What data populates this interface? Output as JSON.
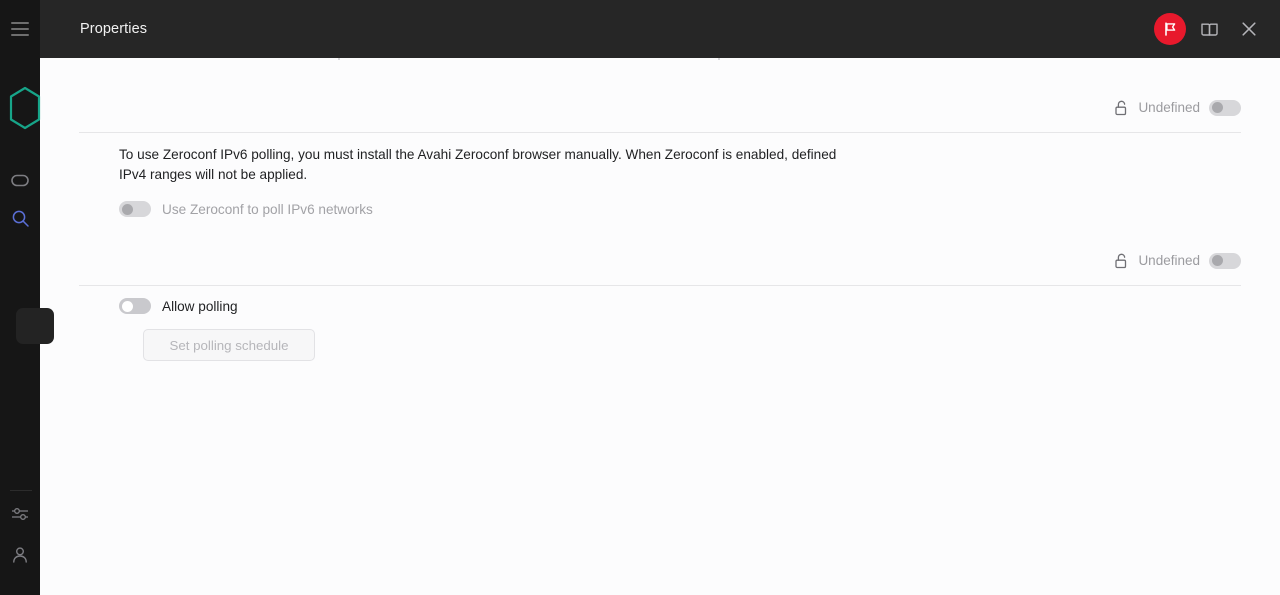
{
  "window": {
    "title": "Properties"
  },
  "header": {
    "title": "Properties",
    "actions": [
      {
        "name": "flag-button",
        "icon": "flag-icon",
        "color": "#e8192c"
      },
      {
        "name": "book-button",
        "icon": "book-icon"
      },
      {
        "name": "close-button",
        "icon": "close-icon"
      }
    ]
  },
  "sidebar": {
    "menu_icon": "hamburger-menu-icon",
    "logo": "hexagon-logo",
    "logo_color": "#17a589",
    "items": [
      {
        "name": "tag-icon"
      },
      {
        "name": "search-icon",
        "color": "#5b6fd6"
      },
      {
        "name": "tune-icon"
      },
      {
        "name": "user-icon"
      }
    ]
  },
  "main": {
    "rows": [
      {
        "lock_icon": "unlock-icon",
        "label": "Undefined",
        "toggle_state": "off",
        "toggle_enabled": false
      },
      {
        "lock_icon": "unlock-icon",
        "label": "Undefined",
        "toggle_state": "off",
        "toggle_enabled": false
      }
    ],
    "zeroconf": {
      "description": "To use Zeroconf IPv6 polling, you must install the Avahi Zeroconf browser manually. When Zeroconf is enabled, defined IPv4 ranges will not be applied.",
      "toggle_label": "Use Zeroconf to poll IPv6 networks",
      "toggle_state": "off",
      "toggle_enabled": false
    },
    "polling": {
      "toggle_label": "Allow polling",
      "toggle_state": "off",
      "toggle_enabled": true,
      "button_label": "Set polling schedule",
      "button_enabled": false
    }
  },
  "colors": {
    "header_bg": "#262626",
    "rail_bg": "#161616",
    "content_bg": "#fcfcfd",
    "accent_red": "#e8192c",
    "accent_teal": "#17a589"
  }
}
